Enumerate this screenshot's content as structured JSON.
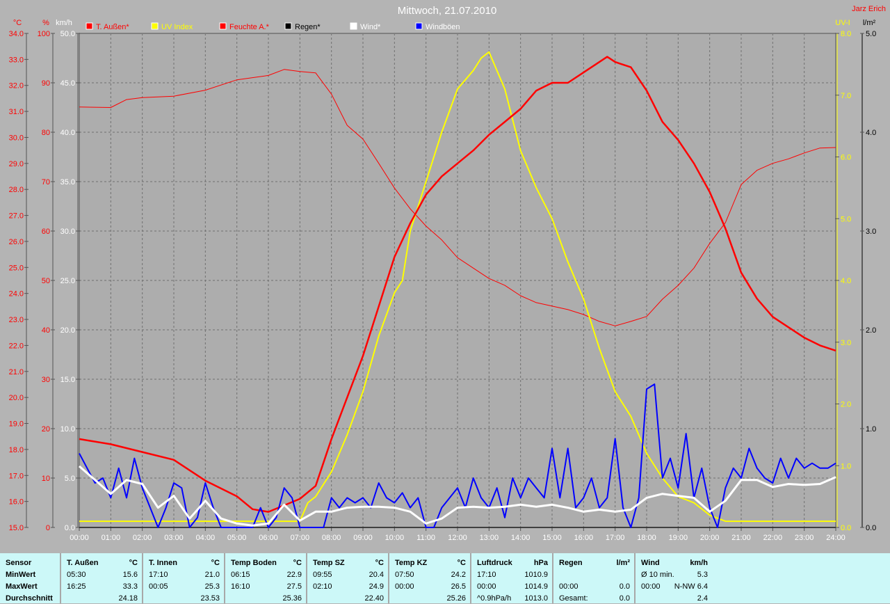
{
  "title": "Mittwoch, 21.07.2010",
  "author": "Jarz Erich",
  "legend": [
    {
      "label": "T. Außen*",
      "color": "#ff0000",
      "text_color": "#ff0000"
    },
    {
      "label": "UV Index",
      "color": "#ffff00",
      "text_color": "#ffff00"
    },
    {
      "label": "Feuchte A.*",
      "color": "#ff0000",
      "text_color": "#ff0000"
    },
    {
      "label": "Regen*",
      "color": "#000000",
      "text_color": "#000000"
    },
    {
      "label": "Wind*",
      "color": "#ffffff",
      "text_color": "#ffffff"
    },
    {
      "label": "Windböen",
      "color": "#0000ff",
      "text_color": "#ffffff"
    }
  ],
  "chart_data": {
    "type": "line",
    "title": "Mittwoch, 21.07.2010",
    "xlabel": "",
    "x_ticks": [
      "00:00",
      "01:00",
      "02:00",
      "03:00",
      "04:00",
      "05:00",
      "06:00",
      "07:00",
      "08:00",
      "09:00",
      "10:00",
      "11:00",
      "12:00",
      "13:00",
      "14:00",
      "15:00",
      "16:00",
      "17:00",
      "18:00",
      "19:00",
      "20:00",
      "21:00",
      "22:00",
      "23:00",
      "24:00"
    ],
    "xlim": [
      0,
      24
    ],
    "grid": true,
    "legend_placement": "top",
    "axes": {
      "temp": {
        "unit": "°C",
        "range": [
          15,
          34
        ],
        "step": 1,
        "color": "#ff0000",
        "side": "left"
      },
      "humidity": {
        "unit": "%",
        "range": [
          0,
          100
        ],
        "step": 10,
        "color": "#ff0000",
        "side": "left"
      },
      "wind": {
        "unit": "km/h",
        "range": [
          0,
          50
        ],
        "step": 5,
        "color": "#ffffff",
        "side": "left"
      },
      "uv": {
        "unit": "UV-I",
        "range": [
          0,
          8
        ],
        "step": 1,
        "color": "#ffff00",
        "side": "right"
      },
      "rain": {
        "unit": "l/m²",
        "range": [
          0,
          5
        ],
        "step": 1,
        "color": "#000000",
        "side": "right"
      }
    },
    "series": [
      {
        "name": "T. Außen*",
        "axis": "temp",
        "color": "#ff0000",
        "width": 2.5,
        "x": [
          0,
          1,
          2,
          3,
          4,
          5,
          5.5,
          6,
          7,
          7.5,
          8,
          8.5,
          9,
          9.5,
          10,
          10.5,
          11,
          11.5,
          12,
          12.5,
          13,
          13.5,
          14,
          14.5,
          15,
          15.5,
          16,
          16.5,
          16.75,
          17,
          17.5,
          18,
          18.5,
          19,
          19.5,
          20,
          20.5,
          21,
          21.5,
          22,
          22.5,
          23,
          23.5,
          24
        ],
        "y": [
          18.4,
          18.2,
          17.9,
          17.6,
          16.8,
          16.2,
          15.7,
          15.6,
          16.1,
          16.6,
          18.4,
          20.0,
          21.6,
          23.5,
          25.4,
          26.7,
          27.8,
          28.5,
          29.0,
          29.5,
          30.1,
          30.6,
          31.1,
          31.8,
          32.1,
          32.1,
          32.5,
          32.9,
          33.1,
          32.9,
          32.7,
          31.8,
          30.6,
          29.9,
          29.0,
          27.9,
          26.5,
          24.8,
          23.8,
          23.1,
          22.7,
          22.3,
          22.0,
          21.8
        ]
      },
      {
        "name": "Feuchte A.*",
        "axis": "humidity",
        "color": "#ff0000",
        "width": 1,
        "x": [
          0,
          1,
          1.5,
          2,
          3,
          4,
          5,
          6,
          6.5,
          7,
          7.5,
          8,
          8.5,
          9,
          9.5,
          10,
          10.5,
          11,
          11.5,
          12,
          12.5,
          13,
          13.5,
          14,
          14.5,
          15,
          15.5,
          16,
          16.5,
          17,
          17.5,
          18,
          18.5,
          19,
          19.5,
          20,
          20.5,
          21,
          21.5,
          22,
          22.5,
          23,
          23.5,
          24
        ],
        "y": [
          85.1,
          85,
          86.6,
          87,
          87.3,
          88.5,
          90.6,
          91.5,
          92.7,
          92.3,
          92,
          87.7,
          81.4,
          78.6,
          73.7,
          68.7,
          64.5,
          61,
          58.2,
          54.6,
          52.5,
          50.4,
          49,
          46.9,
          45.5,
          44.8,
          44.1,
          43.1,
          41.7,
          40.8,
          41.7,
          42.7,
          46.2,
          49,
          52.5,
          57.5,
          61.7,
          69.4,
          72.3,
          73.7,
          74.6,
          75.8,
          76.8,
          76.9
        ]
      },
      {
        "name": "UV Index",
        "axis": "uv",
        "color": "#ffff00",
        "width": 2,
        "x": [
          0,
          7,
          7.25,
          7.5,
          8,
          8.5,
          9,
          9.5,
          10,
          10.25,
          10.5,
          11,
          11.5,
          12,
          12.5,
          12.75,
          13,
          13.5,
          14,
          14.5,
          15,
          15.5,
          16,
          16.5,
          17,
          17.5,
          18,
          18.5,
          19,
          19.5,
          20,
          20.5,
          24
        ],
        "y": [
          0.1,
          0.1,
          0.4,
          0.5,
          0.9,
          1.5,
          2.2,
          3.1,
          3.8,
          4.0,
          4.8,
          5.6,
          6.4,
          7.1,
          7.4,
          7.6,
          7.7,
          7.1,
          6.1,
          5.5,
          5.0,
          4.3,
          3.7,
          2.9,
          2.2,
          1.8,
          1.2,
          0.8,
          0.5,
          0.4,
          0.2,
          0.1,
          0.1
        ]
      },
      {
        "name": "Wind*",
        "axis": "wind",
        "color": "#ffffff",
        "width": 3,
        "x": [
          0,
          0.5,
          1,
          1.5,
          2,
          2.5,
          3,
          3.5,
          4,
          4.5,
          5,
          5.5,
          6,
          6.5,
          7,
          7.5,
          8,
          8.5,
          9,
          9.5,
          10,
          10.5,
          11,
          11.5,
          12,
          12.5,
          13,
          13.5,
          14,
          14.5,
          15,
          15.5,
          16,
          16.5,
          17,
          17.5,
          18,
          18.5,
          19,
          19.5,
          20,
          20.5,
          21,
          21.5,
          22,
          22.5,
          23,
          23.5,
          24
        ],
        "y": [
          6.2,
          4.8,
          3.4,
          4.8,
          4.4,
          2.0,
          3.2,
          0.9,
          2.7,
          0.9,
          0.4,
          0.2,
          0.4,
          2.3,
          0.7,
          1.6,
          1.6,
          2.0,
          2.1,
          2.1,
          2.0,
          1.6,
          0.4,
          0.9,
          2.0,
          2.1,
          2.0,
          2.1,
          2.3,
          2.1,
          2.3,
          2.0,
          1.6,
          1.8,
          1.6,
          1.8,
          3.0,
          3.4,
          3.2,
          3.0,
          1.6,
          2.7,
          4.8,
          4.8,
          4.1,
          4.4,
          4.3,
          4.4,
          5.1
        ]
      },
      {
        "name": "Windböen",
        "axis": "wind",
        "color": "#0000ff",
        "width": 2,
        "x_step": 0.25,
        "y": [
          7.5,
          6,
          4.5,
          5,
          3,
          6,
          3,
          7,
          4,
          2,
          0,
          2,
          4.5,
          4,
          0,
          1,
          4.5,
          2,
          0,
          0,
          0,
          0,
          0,
          2,
          0,
          1,
          4,
          3,
          0,
          0,
          0,
          0,
          3,
          2,
          3,
          2.5,
          3,
          2,
          4.5,
          3,
          2.5,
          3.5,
          2,
          3,
          0,
          0,
          2,
          3,
          4,
          2,
          5,
          3,
          2,
          4,
          1,
          5,
          3,
          5,
          4,
          3,
          8,
          3,
          8,
          2,
          3,
          5,
          2,
          3,
          9,
          2,
          0,
          3,
          14,
          14.5,
          5,
          7,
          4,
          9.5,
          3,
          6,
          2,
          0,
          4,
          6,
          5,
          8,
          6,
          5,
          4.5,
          7,
          5,
          7,
          6,
          6.5,
          6,
          6,
          6.5
        ]
      },
      {
        "name": "Regen*",
        "axis": "rain",
        "color": "#000000",
        "width": 1,
        "x": [
          0,
          24
        ],
        "y": [
          0,
          0
        ]
      }
    ]
  },
  "table": {
    "row_labels": [
      "Sensor",
      "MinWert",
      "MaxWert",
      "Durchschnitt"
    ],
    "columns": [
      {
        "name": "T. Außen",
        "unit": "°C",
        "min_time": "05:30",
        "min": "15.6",
        "max_time": "16:25",
        "max": "33.3",
        "avg_label": "",
        "avg": "24.18"
      },
      {
        "name": "T. Innen",
        "unit": "°C",
        "min_time": "17:10",
        "min": "21.0",
        "max_time": "00:05",
        "max": "25.3",
        "avg_label": "",
        "avg": "23.53"
      },
      {
        "name": "Temp Boden",
        "unit": "°C",
        "min_time": "06:15",
        "min": "22.9",
        "max_time": "16:10",
        "max": "27.5",
        "avg_label": "",
        "avg": "25.36"
      },
      {
        "name": "Temp SZ",
        "unit": "°C",
        "min_time": "09:55",
        "min": "20.4",
        "max_time": "02:10",
        "max": "24.9",
        "avg_label": "",
        "avg": "22.40"
      },
      {
        "name": "Temp KZ",
        "unit": "°C",
        "min_time": "07:50",
        "min": "24.2",
        "max_time": "00:00",
        "max": "26.5",
        "avg_label": "",
        "avg": "25.26"
      },
      {
        "name": "Luftdruck",
        "unit": "hPa",
        "min_time": "17:10",
        "min": "1010.9",
        "max_time": "00:00",
        "max": "1014.9",
        "avg_label": "^0.9hPa/h",
        "avg": "1013.0"
      },
      {
        "name": "Regen",
        "unit": "l/m²",
        "min_time": "",
        "min": "",
        "max_time": "00:00",
        "max": "0.0",
        "avg_label": "Gesamt:",
        "avg": "0.0"
      },
      {
        "name": "Wind",
        "unit": "km/h",
        "min_time": "Ø 10 min.",
        "min": "5.3",
        "max_time": "00:00",
        "max": "N-NW 6.4",
        "avg_label": "",
        "avg": "2.4"
      }
    ]
  }
}
